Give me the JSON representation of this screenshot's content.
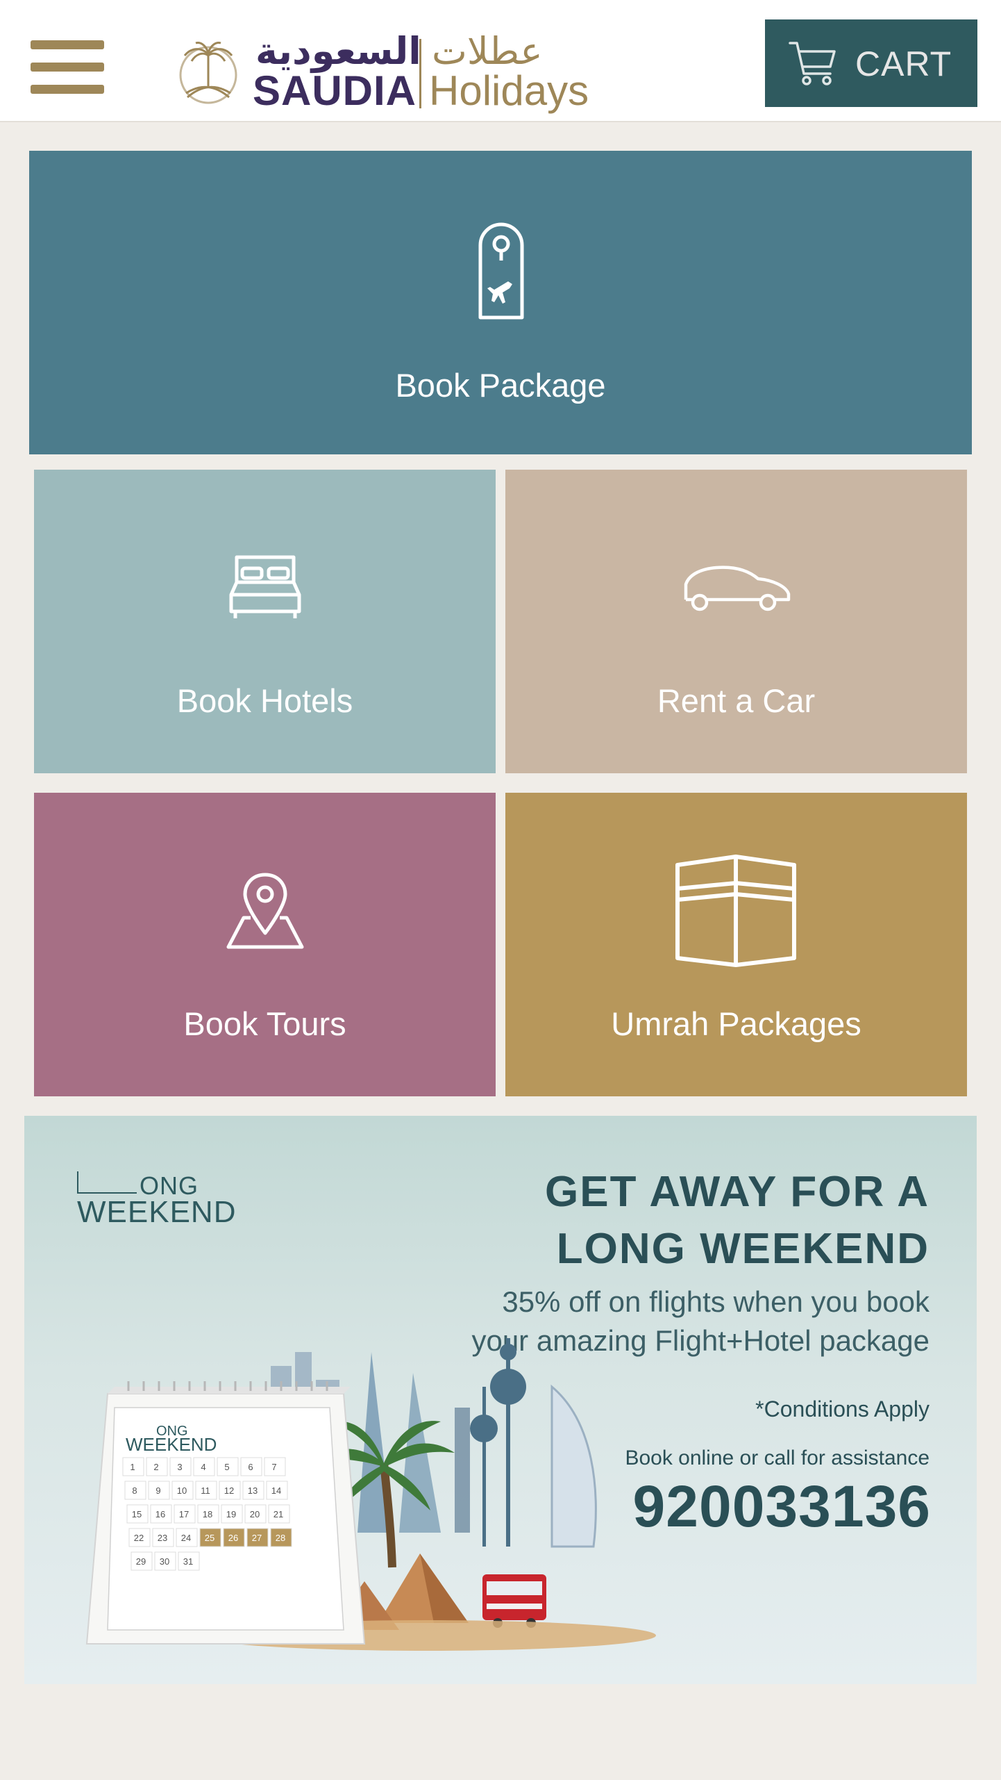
{
  "header": {
    "logo": {
      "arabic_brand": "السعودية",
      "arabic_product": "عطلات",
      "brand": "SAUDIA",
      "product": "Holidays"
    },
    "menu_icon": "hamburger-menu-icon",
    "cart": {
      "label": "CART",
      "icon": "shopping-cart-icon"
    }
  },
  "tiles": [
    {
      "label": "Book Package",
      "icon": "door-hanger-plane-icon",
      "color": "#4c7c8c"
    },
    {
      "label": "Book Hotels",
      "icon": "bed-icon",
      "color": "#9cbabc"
    },
    {
      "label": "Rent a Car",
      "icon": "car-icon",
      "color": "#c9b6a3"
    },
    {
      "label": "Book Tours",
      "icon": "map-pin-icon",
      "color": "#a66f85"
    },
    {
      "label": "Umrah Packages",
      "icon": "kaaba-icon",
      "color": "#b7975b"
    }
  ],
  "banner": {
    "brand_line1": "ONG",
    "brand_line2": "WEEKEND",
    "headline_1": "GET AWAY FOR A",
    "headline_2": "LONG WEEKEND",
    "sub_1": "35% off on flights when you book",
    "sub_2": "your amazing Flight+Hotel package",
    "conditions": "*Conditions Apply",
    "call_text": "Book online or call for assistance",
    "phone": "920033136",
    "calendar_brand_1": "ONG",
    "calendar_brand_2": "WEEKEND",
    "calendar_days": [
      "1",
      "2",
      "3",
      "4",
      "5",
      "6",
      "7",
      "8",
      "9",
      "10",
      "11",
      "12",
      "13",
      "14",
      "15",
      "16",
      "17",
      "18",
      "19",
      "20",
      "21",
      "22",
      "23",
      "24",
      "25",
      "26",
      "27",
      "28",
      "29",
      "30",
      "31"
    ]
  },
  "colors": {
    "gold": "#9e8758",
    "purple": "#3c2d5e",
    "cart_bg": "#2f5a5f",
    "page_bg": "#f0ede8"
  }
}
